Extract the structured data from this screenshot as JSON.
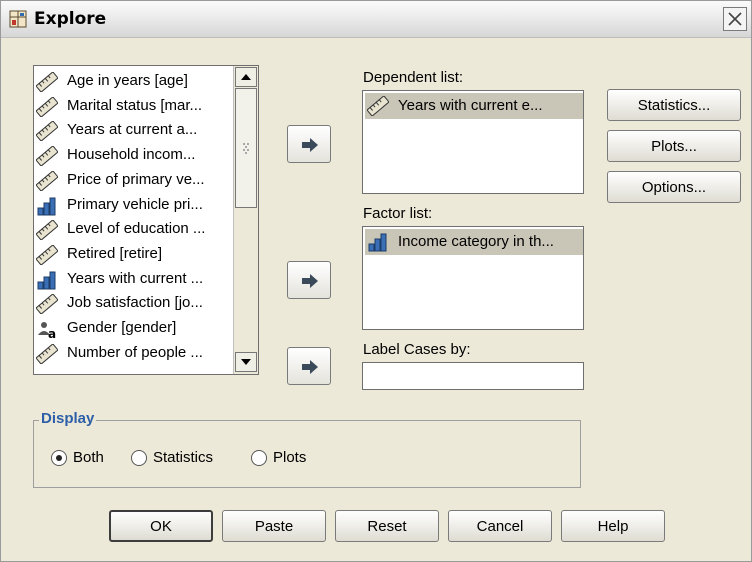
{
  "window": {
    "title": "Explore"
  },
  "variables": [
    {
      "label": "Age in years [age]",
      "icon": "scale-ruler-icon"
    },
    {
      "label": "Marital status [mar...",
      "icon": "scale-ruler-icon"
    },
    {
      "label": "Years at current a...",
      "icon": "scale-ruler-icon"
    },
    {
      "label": "Household incom...",
      "icon": "scale-ruler-icon"
    },
    {
      "label": "Price of primary ve...",
      "icon": "scale-ruler-icon"
    },
    {
      "label": "Primary vehicle pri...",
      "icon": "ordinal-bars-icon"
    },
    {
      "label": "Level of education ...",
      "icon": "scale-ruler-icon"
    },
    {
      "label": "Retired [retire]",
      "icon": "scale-ruler-icon"
    },
    {
      "label": "Years with current ...",
      "icon": "ordinal-bars-icon"
    },
    {
      "label": "Job satisfaction [jo...",
      "icon": "scale-ruler-icon"
    },
    {
      "label": "Gender [gender]",
      "icon": "nominal-string-icon"
    },
    {
      "label": "Number of people ...",
      "icon": "scale-ruler-icon"
    }
  ],
  "dependent_list": {
    "label": "Dependent list:",
    "items": [
      {
        "label": "Years with current e...",
        "icon": "scale-ruler-icon"
      }
    ]
  },
  "factor_list": {
    "label": "Factor list:",
    "items": [
      {
        "label": "Income category in th...",
        "icon": "ordinal-bars-icon"
      }
    ]
  },
  "label_cases": {
    "label": "Label Cases by:",
    "value": ""
  },
  "side_buttons": {
    "statistics": "Statistics...",
    "plots": "Plots...",
    "options": "Options..."
  },
  "display": {
    "title": "Display",
    "options": [
      {
        "label": "Both",
        "selected": true
      },
      {
        "label": "Statistics",
        "selected": false
      },
      {
        "label": "Plots",
        "selected": false
      }
    ]
  },
  "footer_buttons": {
    "ok": "OK",
    "paste": "Paste",
    "reset": "Reset",
    "cancel": "Cancel",
    "help": "Help"
  },
  "colors": {
    "dialog_bg": "#ece9d8",
    "group_title": "#2d5fa8",
    "selection": "#c9c6b8"
  }
}
